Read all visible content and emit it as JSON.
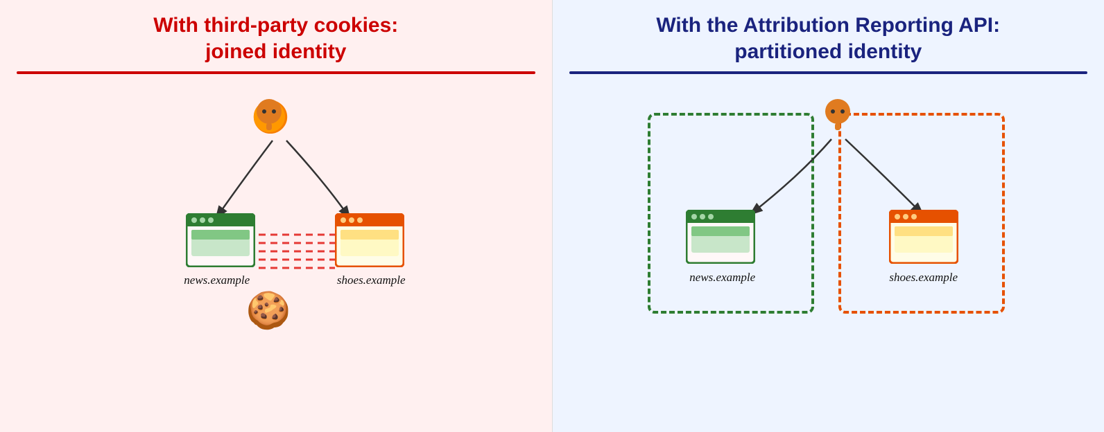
{
  "left": {
    "title_line1": "With third-party cookies:",
    "title_line2": "joined identity",
    "site1": "news.example",
    "site2": "shoes.example"
  },
  "right": {
    "title_line1": "With the Attribution Reporting API:",
    "title_line2": "partitioned identity",
    "site1": "news.example",
    "site2": "shoes.example"
  }
}
